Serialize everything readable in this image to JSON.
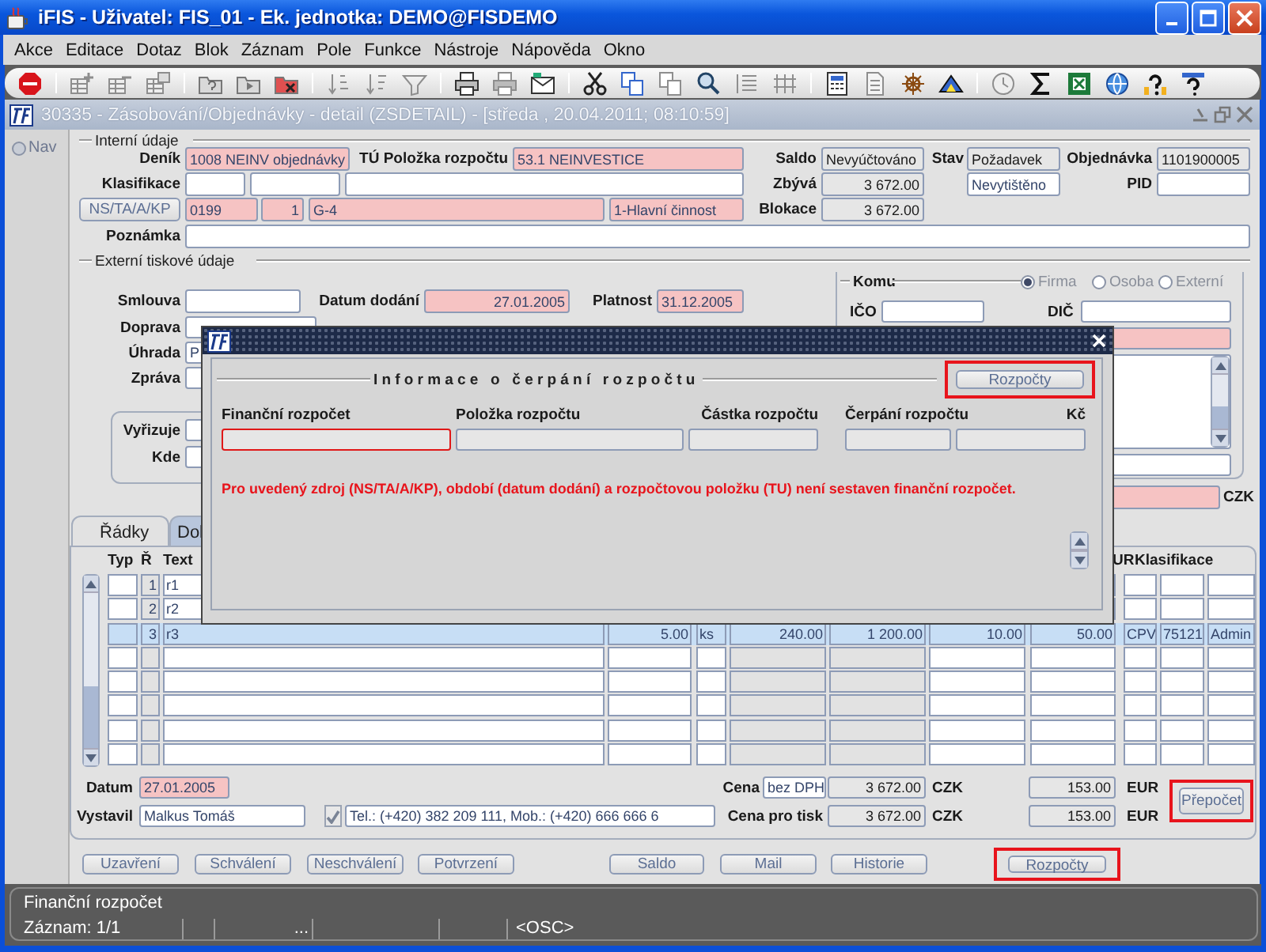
{
  "window": {
    "title": "iFIS - Uživatel: FIS_01 - Ek. jednotka: DEMO@FISDEMO"
  },
  "menu": [
    "Akce",
    "Editace",
    "Dotaz",
    "Blok",
    "Záznam",
    "Pole",
    "Funkce",
    "Nástroje",
    "Nápověda",
    "Okno"
  ],
  "form_window": {
    "title": "30335 - Zásobování/Objednávky - detail (ZSDETAIL) - [středa , 20.04.2011; 08:10:59]",
    "nav": "Nav"
  },
  "internal": {
    "heading": "Interní údaje",
    "denik": {
      "label": "Deník",
      "value": "1008 NEINV objednávky",
      "kind": "required"
    },
    "tu_polozka": {
      "label": "TÚ Položka rozpočtu",
      "value": "53.1 NEINVESTICE",
      "kind": "required"
    },
    "saldo": {
      "label": "Saldo",
      "value": "Nevyúčtováno",
      "kind": "readonly"
    },
    "stav": {
      "label": "Stav",
      "value": "Požadavek",
      "kind": "readonly"
    },
    "objednavka": {
      "label": "Objednávka",
      "value": "1101900005",
      "kind": "readonly"
    },
    "klasifikace": {
      "label": "Klasifikace",
      "fields": [
        {
          "kind": "editable"
        },
        {
          "kind": "editable"
        },
        {
          "kind": "editable"
        }
      ]
    },
    "zbyva": {
      "label": "Zbývá",
      "value": "3 672.00",
      "kind": "readonly"
    },
    "tisk": {
      "value": "Nevytištěno",
      "kind": "editable"
    },
    "pid": {
      "label": "PID",
      "kind": "editable"
    },
    "zdroj": {
      "button": "NS/TA/A/KP",
      "fields": [
        {
          "value": "0199",
          "kind": "required"
        },
        {
          "value": "1",
          "kind": "required"
        },
        {
          "value": "G-4",
          "kind": "required"
        },
        {
          "value": "1-Hlavní činnost",
          "kind": "required"
        }
      ]
    },
    "blokace": {
      "label": "Blokace",
      "value": "3 672.00",
      "kind": "readonly"
    },
    "poznamka": {
      "label": "Poznámka",
      "kind": "editable"
    }
  },
  "external": {
    "heading": "Externí tiskové údaje",
    "smlouva": {
      "label": "Smlouva",
      "kind": "editable"
    },
    "datum_dodani": {
      "label": "Datum dodání",
      "value": "27.01.2005",
      "kind": "required"
    },
    "platnost": {
      "label": "Platnost",
      "value": "31.12.2005",
      "kind": "required"
    },
    "doprava": {
      "label": "Doprava",
      "kind": "editable"
    },
    "uhrada": {
      "label": "Úhrada",
      "value": "P",
      "kind": "editable"
    },
    "zprava": {
      "label": "Zpráva",
      "kind": "editable"
    },
    "vyrizuje": {
      "label": "Vyřizuje",
      "kind": "editable"
    },
    "kde": {
      "label": "Kde",
      "kind": "editable"
    },
    "komu": {
      "heading": "Komu",
      "options": [
        {
          "label": "Firma",
          "selected": true
        },
        {
          "label": "Osoba",
          "selected": false
        },
        {
          "label": "Externí",
          "selected": false
        }
      ],
      "ico": {
        "label": "IČO",
        "kind": "editable"
      },
      "dic": {
        "label": "DIČ",
        "kind": "editable"
      },
      "fields": [
        {
          "kind": "required"
        },
        {
          "kind": "editable"
        },
        {
          "kind": "editable"
        }
      ]
    },
    "amount": {
      "kind": "required",
      "currency": "CZK"
    }
  },
  "tabs": [
    {
      "label": "Řádky",
      "selected": true
    },
    {
      "label": "Dol",
      "selected": false
    }
  ],
  "table": {
    "columns": [
      "Typ",
      "Ř",
      "Text",
      "UR",
      "Klasifikace"
    ],
    "rows": [
      {
        "selected": false,
        "line": "1",
        "text": "r1"
      },
      {
        "selected": false,
        "line": "2",
        "text": "r2"
      },
      {
        "selected": true,
        "line": "3",
        "text": "r3",
        "column_4": "5.00",
        "column_5": "ks",
        "column_6": "240.00",
        "column_7": "1 200.00",
        "column_8": "10.00",
        "column_9": "50.00",
        "column_10": "CPV",
        "column_11": "75121",
        "column_12": "Admin"
      },
      {
        "selected": false
      },
      {
        "selected": false
      },
      {
        "selected": false
      },
      {
        "selected": false
      },
      {
        "selected": false
      }
    ]
  },
  "footer": {
    "datum": {
      "label": "Datum",
      "value": "27.01.2005",
      "kind": "required"
    },
    "vystavil": {
      "label": "Vystavil",
      "value": "Malkus Tomáš",
      "kind": "editable"
    },
    "contact": {
      "checked": true,
      "value": "Tel.: (+420) 382 209 111, Mob.: (+420) 666 666 6",
      "kind": "editable"
    },
    "cena": {
      "label": "Cena",
      "basis": {
        "value": "bez DPH",
        "kind": "editable"
      },
      "czk": {
        "value": "3 672.00",
        "kind": "readonly"
      },
      "czk_unit": "CZK",
      "eur": {
        "value": "153.00",
        "kind": "readonly"
      },
      "eur_unit": "EUR"
    },
    "cena_tisk": {
      "label": "Cena pro tisk",
      "czk": {
        "value": "3 672.00",
        "kind": "readonly"
      },
      "czk_unit": "CZK",
      "eur": {
        "value": "153.00",
        "kind": "readonly"
      },
      "eur_unit": "EUR"
    },
    "recalc_button": {
      "label": "Přepočet",
      "highlighted": true
    }
  },
  "buttons": [
    {
      "label": "Uzavření",
      "highlighted": false
    },
    {
      "label": "Schválení",
      "highlighted": false
    },
    {
      "label": "Neschválení",
      "highlighted": false
    },
    {
      "label": "Potvrzení",
      "highlighted": false
    },
    {
      "label": "Saldo",
      "highlighted": false
    },
    {
      "label": "Mail",
      "highlighted": false
    },
    {
      "label": "Historie",
      "highlighted": false
    },
    {
      "label": "Rozpočty",
      "highlighted": true
    }
  ],
  "dialog": {
    "heading": "Informace o čerpání rozpočtu",
    "button": {
      "label": "Rozpočty",
      "highlighted": true
    },
    "columns": [
      {
        "label": "Finanční rozpočet",
        "kind": "readonly",
        "focused": true
      },
      {
        "label": "Položka rozpočtu",
        "kind": "readonly",
        "focused": false
      },
      {
        "label": "Částka rozpočtu",
        "kind": "readonly",
        "focused": false
      },
      {
        "label": "Čerpání rozpočtu",
        "kind": "readonly",
        "focused": false
      },
      {
        "label": "Kč",
        "kind": "readonly",
        "focused": false
      }
    ],
    "message": "Pro uvedený zdroj (NS/TA/A/KP), období (datum dodání) a rozpočtovou položku (TU) není sestaven finanční rozpočet."
  },
  "status_bar": {
    "message": "Finanční rozpočet",
    "record": "Záznam: 1/1",
    "cells": [
      "...",
      "<OSC>"
    ]
  }
}
